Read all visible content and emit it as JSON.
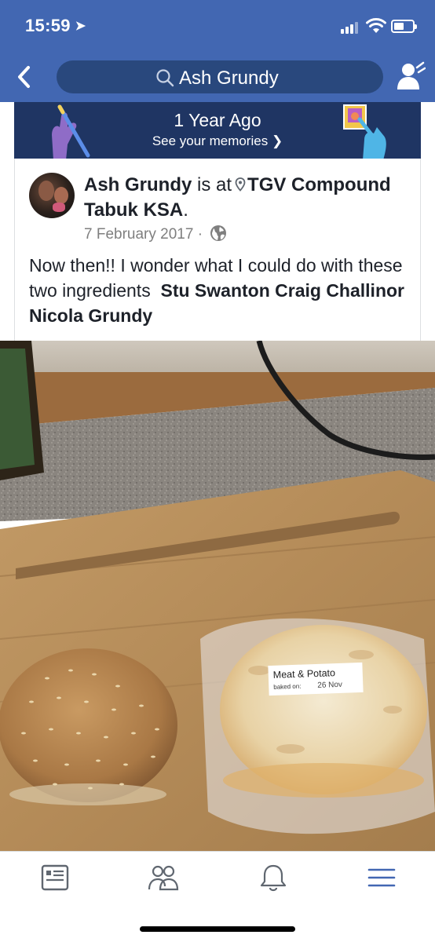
{
  "status_bar": {
    "time": "15:59"
  },
  "search": {
    "query": "Ash Grundy"
  },
  "memories": {
    "title": "1 Year Ago",
    "subtitle": "See your memories"
  },
  "post": {
    "author": "Ash Grundy",
    "is_at": "is at",
    "place": "TGV Compound Tabuk KSA",
    "date": "7 February 2017",
    "separator": "·",
    "text": "Now then!! I wonder what I could do with these two ingredients",
    "tagged": "Stu Swanton Craig Challinor Nicola Grundy",
    "photo_label_line1": "Meat & Potato",
    "photo_label_line2": "baked on:",
    "photo_label_date": "26 Nov"
  },
  "colors": {
    "brand": "#4267b2",
    "search_bg": "#29487d",
    "memories_bg": "#1f3563",
    "tab_icon": "#606770",
    "tab_active": "#4267b2"
  },
  "tabbar": {
    "icons": [
      "news-feed-icon",
      "friends-icon",
      "notifications-icon",
      "menu-icon"
    ]
  }
}
